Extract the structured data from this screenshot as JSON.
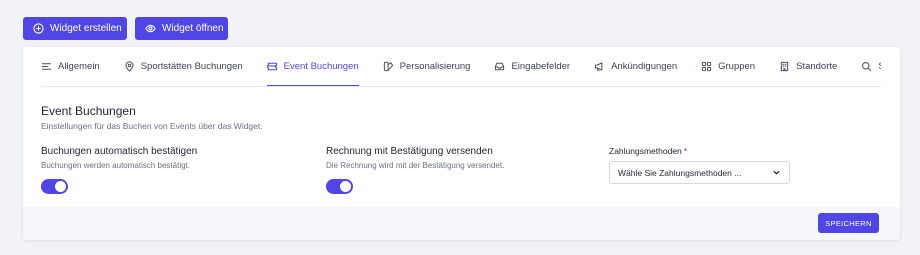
{
  "header_buttons": {
    "create_label": "Widget erstellen",
    "open_label": "Widget öffnen"
  },
  "tabs": [
    {
      "label": "Allgemein",
      "icon": "align-left-icon",
      "active": false
    },
    {
      "label": "Sportstätten Buchungen",
      "icon": "map-pin-icon",
      "active": false
    },
    {
      "label": "Event Buchungen",
      "icon": "ticket-icon",
      "active": true
    },
    {
      "label": "Personalisierung",
      "icon": "palette-icon",
      "active": false
    },
    {
      "label": "Eingabefelder",
      "icon": "inbox-icon",
      "active": false
    },
    {
      "label": "Ankündigungen",
      "icon": "megaphone-icon",
      "active": false
    },
    {
      "label": "Gruppen",
      "icon": "grid-icon",
      "active": false
    },
    {
      "label": "Standorte",
      "icon": "building-icon",
      "active": false
    },
    {
      "label": "Suche",
      "icon": "search-icon",
      "active": false
    },
    {
      "label": "",
      "icon": "credit-card-icon",
      "active": false
    }
  ],
  "section": {
    "title": "Event Buchungen",
    "description": "Einstellungen für das Buchen von Events über das Widget."
  },
  "settings": {
    "auto_confirm": {
      "label": "Buchungen automatisch bestätigen",
      "hint": "Buchungen werden automatisch bestätigt.",
      "enabled": true
    },
    "invoice": {
      "label": "Rechnung mit Bestätigung versenden",
      "hint": "Die Rechnung wird mit der Bestätigung versendet.",
      "enabled": true
    }
  },
  "payment": {
    "label": "Zahlungsmethoden",
    "required_mark": "*",
    "placeholder": "Wähle Sie Zahlungsmethoden ..."
  },
  "footer": {
    "save_label": "SPEICHERN"
  },
  "colors": {
    "accent": "#4f46e5",
    "background": "#f1f3f7",
    "required": "#dc2626"
  }
}
